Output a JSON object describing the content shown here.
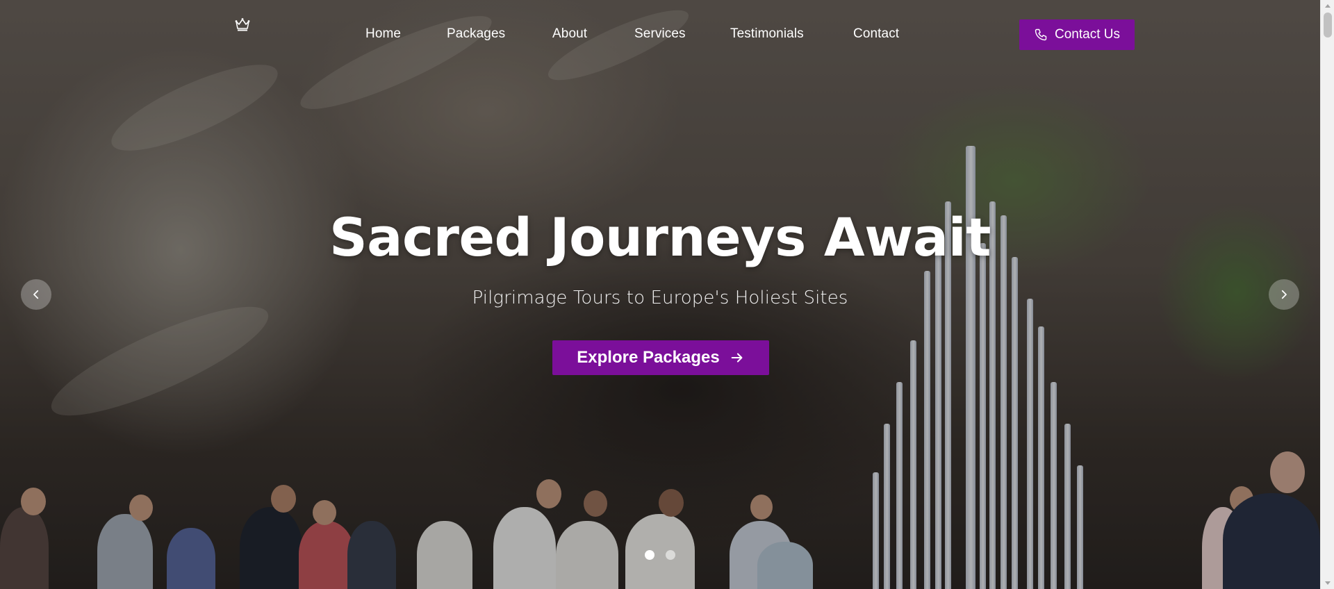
{
  "nav": {
    "logo_icon": "crown-icon",
    "links": [
      {
        "label": "Home"
      },
      {
        "label": "Packages"
      },
      {
        "label": "About"
      },
      {
        "label": "Services"
      },
      {
        "label": "Testimonials"
      },
      {
        "label": "Contact"
      }
    ],
    "cta": {
      "label": "Contact Us",
      "icon": "phone-icon"
    }
  },
  "hero": {
    "title": "Sacred Journeys Await",
    "subtitle": "Pilgrimage Tours to Europe's Holiest Sites",
    "button": {
      "label": "Explore Packages",
      "icon": "arrow-right-icon"
    },
    "carousel": {
      "prev_icon": "chevron-left-icon",
      "next_icon": "chevron-right-icon",
      "slides_count": 2,
      "active_slide": 1
    }
  },
  "colors": {
    "accent": "#7b0f9a",
    "text_on_dark": "#ffffff",
    "dot_active": "#ffffff",
    "dot_inactive": "rgba(255,255,255,0.55)"
  }
}
